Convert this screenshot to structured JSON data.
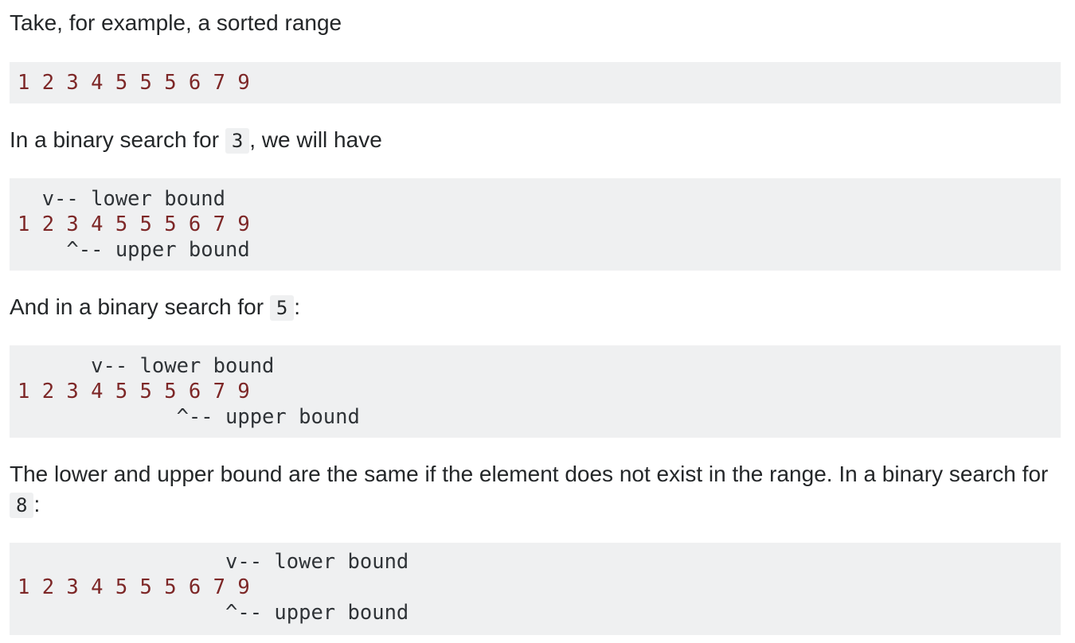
{
  "paragraphs": {
    "intro": "Take, for example, a sorted range",
    "search3_before": "In a binary search for ",
    "search3_code": "3",
    "search3_after": ", we will have",
    "search5_before": "And in a binary search for ",
    "search5_code": "5",
    "search5_after": ":",
    "search8_before": "The lower and upper bound are the same if the element does not exist in the range. In a binary search for ",
    "search8_code": "8",
    "search8_after": ":"
  },
  "code_blocks": {
    "range": {
      "numbers": "1 2 3 4 5 5 5 6 7 9"
    },
    "search3": {
      "lower": "  v-- lower bound",
      "numbers": "1 2 3 4 5 5 5 6 7 9",
      "upper": "    ^-- upper bound"
    },
    "search5": {
      "lower": "      v-- lower bound",
      "numbers": "1 2 3 4 5 5 5 6 7 9",
      "upper": "             ^-- upper bound"
    },
    "search8": {
      "lower": "                 v-- lower bound",
      "numbers": "1 2 3 4 5 5 5 6 7 9",
      "upper": "                 ^-- upper bound"
    }
  }
}
